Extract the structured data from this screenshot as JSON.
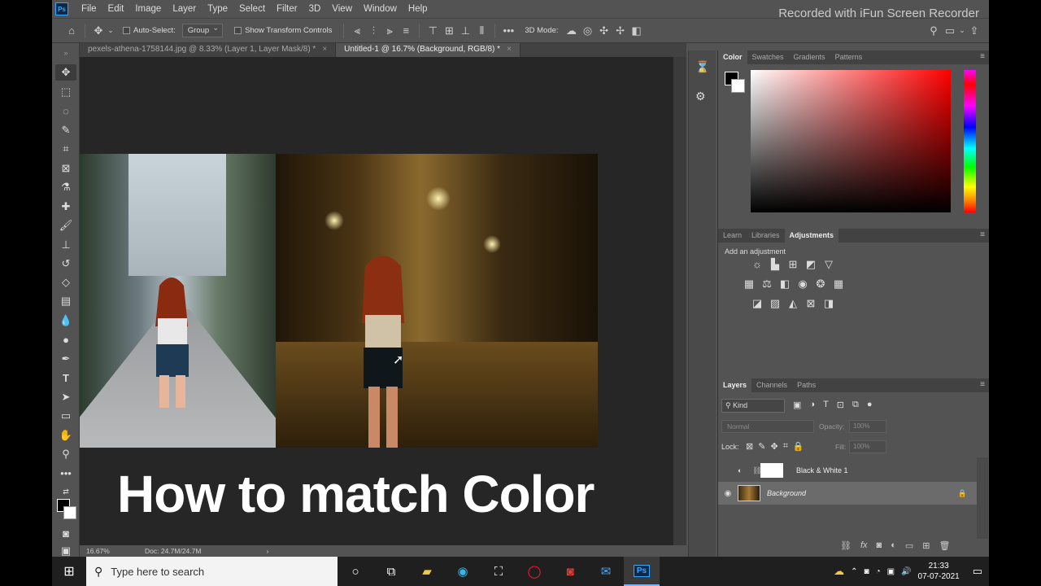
{
  "recorder_watermark": "Recorded with iFun Screen Recorder",
  "menubar": {
    "logo": "Ps",
    "items": [
      "File",
      "Edit",
      "Image",
      "Layer",
      "Type",
      "Select",
      "Filter",
      "3D",
      "View",
      "Window",
      "Help"
    ]
  },
  "options_bar": {
    "auto_select_label": "Auto-Select:",
    "group_value": "Group",
    "transform_label": "Show Transform Controls",
    "mode_3d_label": "3D Mode:",
    "more": "•••"
  },
  "doc_tabs": [
    {
      "label": "pexels-athena-1758144.jpg @ 8.33% (Layer 1, Layer Mask/8) *",
      "close": "×"
    },
    {
      "label": "Untitled-1 @ 16.7% (Background, RGB/8) *",
      "close": "×"
    }
  ],
  "canvas": {
    "overlay_title": "How to match Color"
  },
  "status": {
    "zoom": "16.67%",
    "doc": "Doc: 24.7M/24.7M",
    "arrow": "›"
  },
  "color_panel": {
    "tabs": [
      "Color",
      "Swatches",
      "Gradients",
      "Patterns"
    ],
    "active": "Color"
  },
  "adjustments_panel": {
    "tabs": [
      "Learn",
      "Libraries",
      "Adjustments"
    ],
    "active": "Adjustments",
    "hint": "Add an adjustment"
  },
  "layers_panel": {
    "tabs": [
      "Layers",
      "Channels",
      "Paths"
    ],
    "active": "Layers",
    "filter_value": "Kind",
    "blend_mode": "Normal",
    "opacity_label": "Opacity:",
    "opacity_value": "100%",
    "lock_label": "Lock:",
    "fill_label": "Fill:",
    "fill_value": "100%",
    "layers": [
      {
        "name": "Black & White 1",
        "visible": false
      },
      {
        "name": "Background",
        "visible": true
      }
    ]
  },
  "taskbar": {
    "search_placeholder": "Type here to search",
    "time": "21:33",
    "date": "07-07-2021"
  },
  "colors": {
    "panel_bg": "#535353",
    "canvas_bg": "#262626",
    "ps_blue": "#31a8ff"
  }
}
